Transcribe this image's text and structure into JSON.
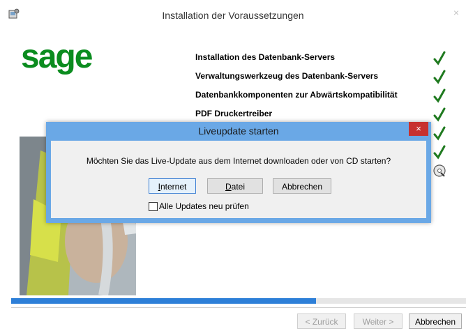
{
  "window": {
    "title": "Installation der Voraussetzungen",
    "close_label": "×"
  },
  "brand": {
    "logo_text": "sage",
    "logo_color": "#0b8c1f"
  },
  "steps": [
    {
      "label": "Installation des Datenbank-Servers",
      "status": "done",
      "icon": "checkmark-icon"
    },
    {
      "label": "Verwaltungswerkzeug des Datenbank-Servers",
      "status": "done",
      "icon": "checkmark-icon"
    },
    {
      "label": "Datenbankkomponenten zur Abwärtskompatibilität",
      "status": "done",
      "icon": "checkmark-icon"
    },
    {
      "label": "PDF Druckertreiber",
      "status": "done",
      "icon": "checkmark-icon"
    },
    {
      "label": "",
      "status": "done",
      "icon": "checkmark-icon"
    },
    {
      "label": "",
      "status": "done",
      "icon": "checkmark-icon"
    },
    {
      "label": "",
      "status": "in-progress",
      "icon": "cd-install-icon"
    }
  ],
  "progress": {
    "fraction": 0.67,
    "color": "#2d7fd8"
  },
  "nav": {
    "back_label": "< Zurück",
    "next_label": "Weiter >",
    "cancel_label": "Abbrechen"
  },
  "dialog": {
    "title": "Liveupdate starten",
    "close_label": "×",
    "message": "Möchten Sie das Live-Update aus dem Internet downloaden oder von CD starten?",
    "buttons": {
      "internet_first": "I",
      "internet_rest": "nternet",
      "datei_first": "D",
      "datei_rest": "atei",
      "abbrechen": "Abbrechen"
    },
    "checkbox": {
      "label": "Alle Updates neu prüfen",
      "checked": false
    },
    "accent": "#6aa8e6",
    "close_color": "#c7312f"
  }
}
